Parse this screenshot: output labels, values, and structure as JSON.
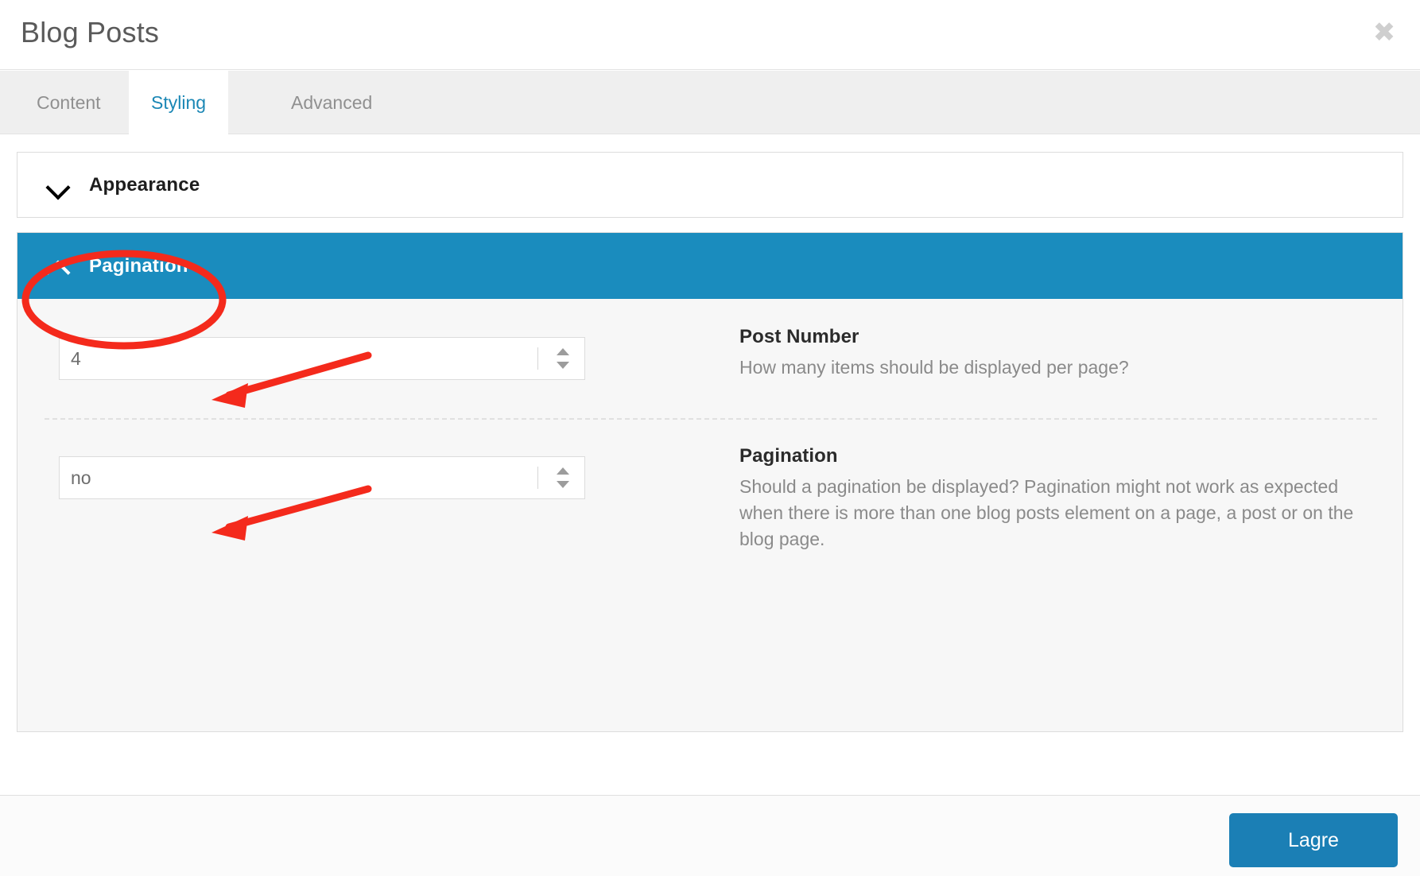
{
  "modal": {
    "title": "Blog Posts",
    "close_icon": "close-icon",
    "close_glyph": "✖"
  },
  "tabs": [
    {
      "label": "Content",
      "active": false
    },
    {
      "label": "Styling",
      "active": true
    },
    {
      "label": "Advanced",
      "active": false
    }
  ],
  "sections": [
    {
      "title": "Appearance",
      "expanded": false,
      "chevron_icon": "chevron-down-icon"
    },
    {
      "title": "Pagination",
      "expanded": true,
      "chevron_icon": "chevron-up-icon"
    }
  ],
  "fields": [
    {
      "value": "4",
      "placeholder": "",
      "label": "Post Number",
      "description": "How many items should be displayed per page?",
      "spinner_icon": "number-stepper-icon"
    },
    {
      "value": "no",
      "placeholder": "",
      "label": "Pagination",
      "description": "Should a pagination be displayed? Pagination might not work as expected when there is more than one blog posts element on a page, a post or on the blog page.",
      "spinner_icon": "number-stepper-icon"
    }
  ],
  "footer": {
    "save_label": "Lagre"
  },
  "colors": {
    "accent_blue": "#1a8cbe",
    "button_blue": "#1b7fb5",
    "tab_active_text": "#1b87b5",
    "annotation_red": "#f42a1c",
    "panel_bg": "#f7f7f7",
    "tabbar_bg": "#efefef"
  },
  "annotations": {
    "ellipse_target": "Pagination",
    "arrow_1_target": "Post Number input",
    "arrow_2_target": "Pagination input"
  }
}
